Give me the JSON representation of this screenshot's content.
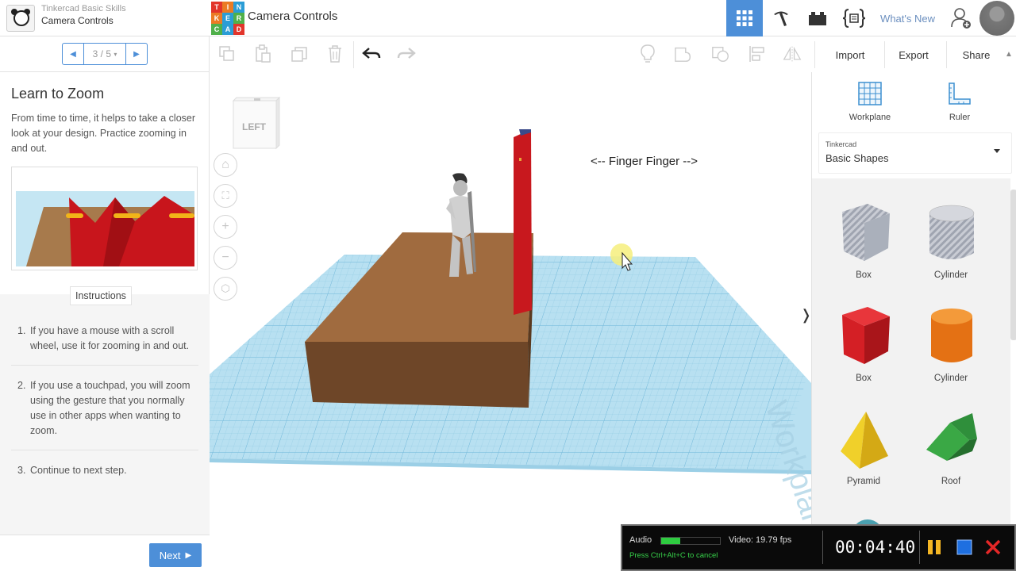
{
  "topbar": {
    "lesson_sup": "Tinkercad Basic Skills",
    "lesson_name": "Camera Controls",
    "logo_letters": [
      "T",
      "I",
      "N",
      "K",
      "E",
      "R",
      "C",
      "A",
      "D"
    ],
    "title": "Camera Controls",
    "whats_new": "What's New"
  },
  "pager": {
    "label": "3 / 5"
  },
  "lesson": {
    "title": "Learn to Zoom",
    "description": "From time to time, it helps to take a closer look at your design. Practice zooming in and out.",
    "instructions_tab": "Instructions",
    "instructions": [
      {
        "num": "1.",
        "text": "If you have a mouse with a scroll wheel, use it for zooming in and out."
      },
      {
        "num": "2.",
        "text": "If you use a touchpad, you will zoom using the gesture that you normally use in other apps when wanting to zoom."
      },
      {
        "num": "3.",
        "text": "Continue to next step."
      }
    ],
    "next_label": "Next"
  },
  "actions": {
    "import": "Import",
    "export": "Export",
    "share": "Share"
  },
  "viewport": {
    "nav_cube_label": "LEFT",
    "annotation": "<-- Finger Finger -->"
  },
  "right_panel": {
    "workplane": "Workplane",
    "ruler": "Ruler",
    "library_sup": "Tinkercad",
    "library_name": "Basic Shapes",
    "shapes": [
      {
        "label": "Box"
      },
      {
        "label": "Cylinder"
      },
      {
        "label": "Box"
      },
      {
        "label": "Cylinder"
      },
      {
        "label": "Pyramid"
      },
      {
        "label": "Roof"
      }
    ]
  },
  "recorder": {
    "audio_label": "Audio",
    "audio_level": 0.32,
    "video_label": "Video: 19.79 fps",
    "cancel_hint": "Press Ctrl+Alt+C to cancel",
    "timer": "00:04:40"
  },
  "colors": {
    "accent": "#4d8fd8",
    "brown_box": "#8b5e3c",
    "red": "#d42428",
    "orange": "#ea7a1b",
    "yellow": "#e8c51e",
    "green": "#3aa845",
    "grid": "#a6d6ec"
  }
}
